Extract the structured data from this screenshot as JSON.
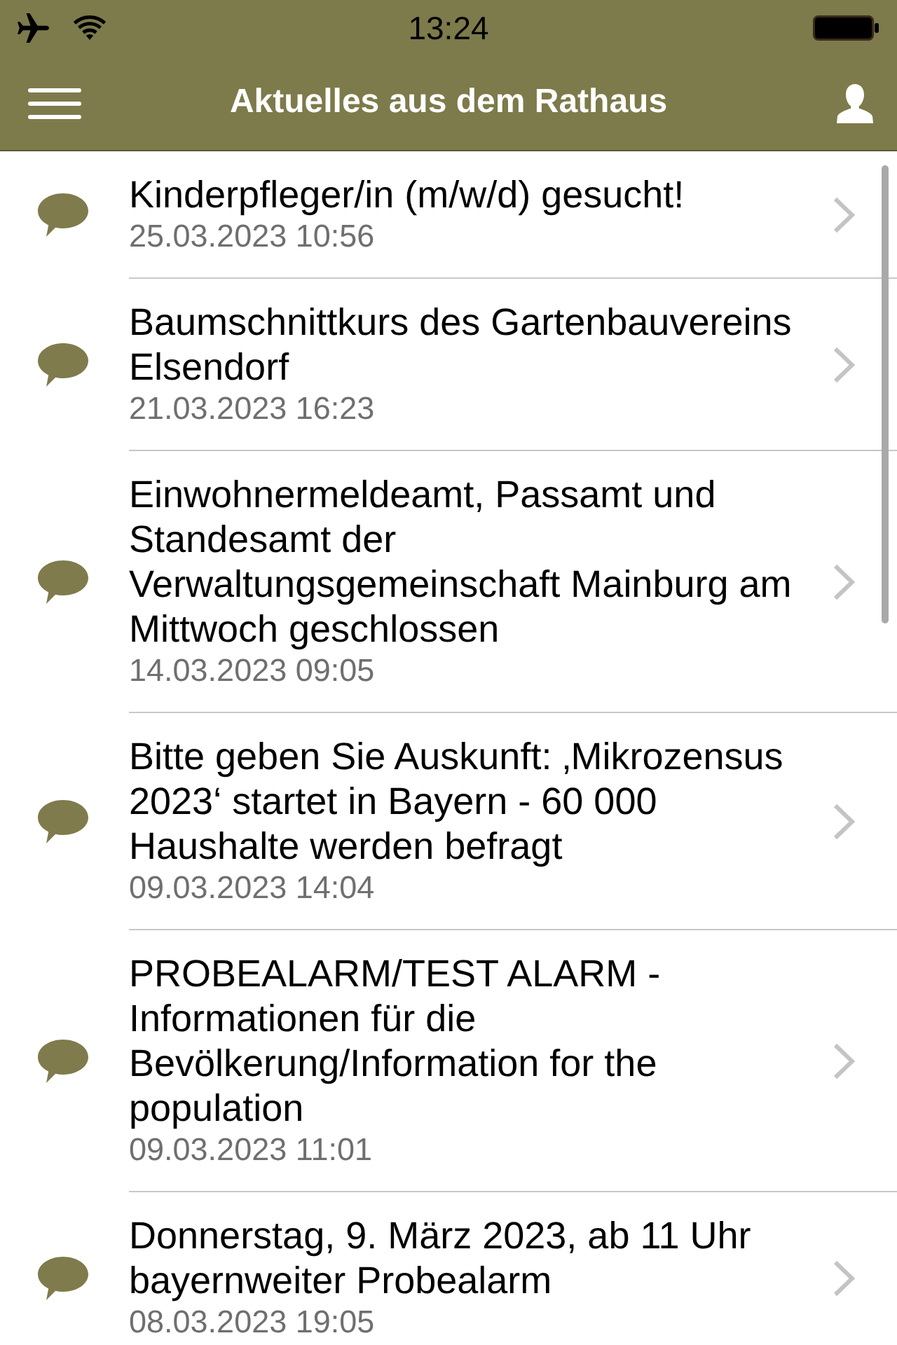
{
  "status_bar": {
    "time": "13:24"
  },
  "nav_bar": {
    "title": "Aktuelles aus dem Rathaus"
  },
  "news": [
    {
      "title": "Kinderpfleger/in (m/w/d) gesucht!",
      "date": "25.03.2023 10:56"
    },
    {
      "title": "Baumschnittkurs des Gartenbauvereins Elsendorf",
      "date": "21.03.2023 16:23"
    },
    {
      "title": "Einwohnermeldeamt, Passamt und Standesamt der Verwaltungsgemeinschaft Mainburg am Mittwoch geschlossen",
      "date": "14.03.2023 09:05"
    },
    {
      "title": "Bitte geben Sie Auskunft: ‚Mikrozensus 2023‘ startet in Bayern - 60 000 Haushalte werden befragt",
      "date": "09.03.2023 14:04"
    },
    {
      "title": "PROBEALARM/TEST ALARM - Informationen für die Bevölkerung/Information for the population",
      "date": "09.03.2023 11:01"
    },
    {
      "title": "Donnerstag, 9. März 2023, ab 11 Uhr bayernweiter Probealarm",
      "date": "08.03.2023 19:05"
    }
  ]
}
